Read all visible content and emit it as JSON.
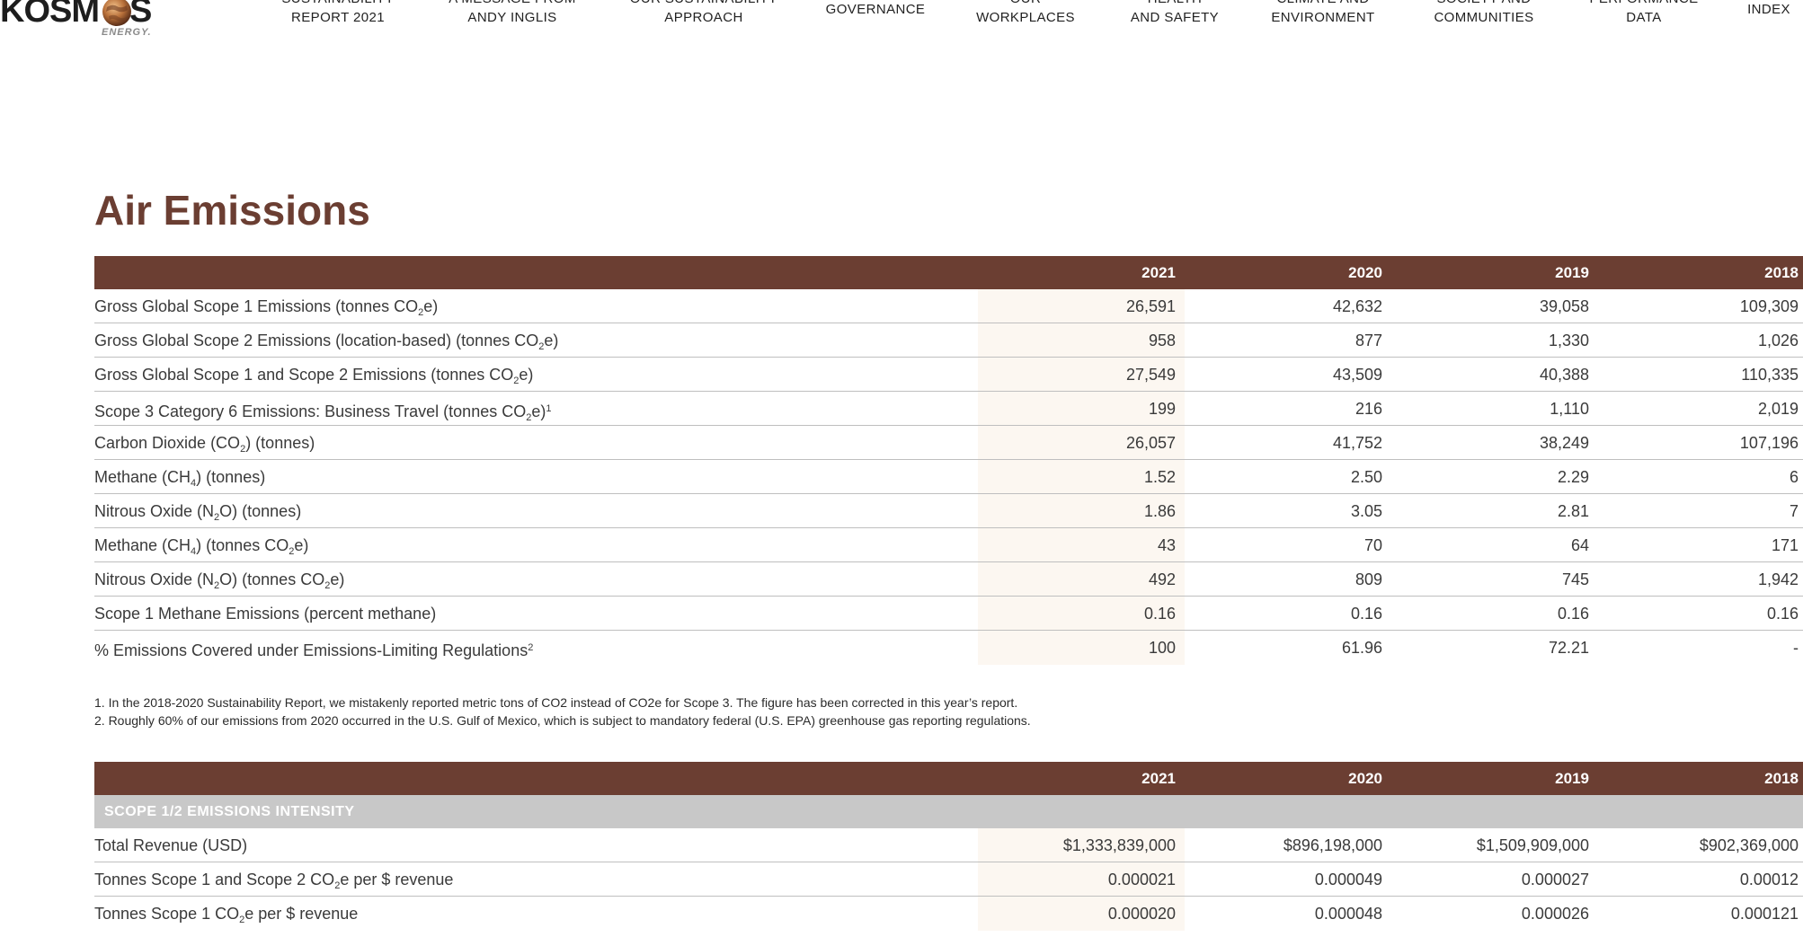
{
  "logo": {
    "text_left": "KOSM",
    "text_right": "S",
    "sub": "ENERGY."
  },
  "nav": [
    {
      "line1": "SUSTAINABILITY",
      "line2": "REPORT 2021"
    },
    {
      "line1": "A MESSAGE FROM",
      "line2": "ANDY INGLIS"
    },
    {
      "line1": "OUR SUSTAINABILITY",
      "line2": "APPROACH"
    },
    {
      "line1": "GOVERNANCE",
      "line2": ""
    },
    {
      "line1": "OUR",
      "line2": "WORKPLACES"
    },
    {
      "line1": "HEALTH",
      "line2": "AND SAFETY"
    },
    {
      "line1": "CLIMATE AND",
      "line2": "ENVIRONMENT"
    },
    {
      "line1": "SOCIETY AND",
      "line2": "COMMUNITIES"
    },
    {
      "line1": "PERFORMANCE",
      "line2": "DATA"
    },
    {
      "line1": "INDEX",
      "line2": ""
    }
  ],
  "page_title": "Air Emissions",
  "colors": {
    "brand_brown": "#6b3e32",
    "highlight_column": "#fcf7f1",
    "section_band": "#c8c8c8"
  },
  "table1": {
    "years": [
      "2021",
      "2020",
      "2019",
      "2018"
    ],
    "rows": [
      {
        "pre": "Gross Global Scope 1 Emissions (tonnes CO",
        "sub": "2",
        "post": "e)",
        "sup": "",
        "values": [
          "26,591",
          "42,632",
          "39,058",
          "109,309"
        ]
      },
      {
        "pre": "Gross Global Scope 2 Emissions (location-based) (tonnes CO",
        "sub": "2",
        "post": "e)",
        "sup": "",
        "values": [
          "958",
          "877",
          "1,330",
          "1,026"
        ]
      },
      {
        "pre": "Gross Global Scope 1 and Scope 2 Emissions (tonnes CO",
        "sub": "2",
        "post": "e)",
        "sup": "",
        "values": [
          "27,549",
          "43,509",
          "40,388",
          "110,335"
        ]
      },
      {
        "pre": "Scope 3 Category 6 Emissions: Business Travel (tonnes CO",
        "sub": "2",
        "post": "e)",
        "sup": "1",
        "values": [
          "199",
          "216",
          "1,110",
          "2,019"
        ]
      },
      {
        "pre": "Carbon Dioxide (CO",
        "sub": "2",
        "post": ") (tonnes)",
        "sup": "",
        "values": [
          "26,057",
          "41,752",
          "38,249",
          "107,196"
        ]
      },
      {
        "pre": "Methane (CH",
        "sub": "4",
        "post": ") (tonnes)",
        "sup": "",
        "values": [
          "1.52",
          "2.50",
          "2.29",
          "6"
        ]
      },
      {
        "pre": "Nitrous Oxide (N",
        "sub": "2",
        "post": "O) (tonnes)",
        "sup": "",
        "values": [
          "1.86",
          "3.05",
          "2.81",
          "7"
        ]
      },
      {
        "pre": "Methane (CH",
        "sub": "4",
        "post": ") (tonnes CO",
        "sub2": "2",
        "post2": "e)",
        "sup": "",
        "values": [
          "43",
          "70",
          "64",
          "171"
        ]
      },
      {
        "pre": "Nitrous Oxide (N",
        "sub": "2",
        "post": "O) (tonnes CO",
        "sub2": "2",
        "post2": "e)",
        "sup": "",
        "values": [
          "492",
          "809",
          "745",
          "1,942"
        ]
      },
      {
        "pre": "Scope 1 Methane Emissions (percent methane)",
        "sub": "",
        "post": "",
        "sup": "",
        "values": [
          "0.16",
          "0.16",
          "0.16",
          "0.16"
        ]
      },
      {
        "pre": "% Emissions Covered under Emissions-Limiting Regulations",
        "sub": "",
        "post": "",
        "sup": "2",
        "values": [
          "100",
          "61.96",
          "72.21",
          "-"
        ]
      }
    ]
  },
  "footnotes": [
    "1.  In the 2018-2020 Sustainability Report, we mistakenly reported metric tons of CO2 instead of CO2e for Scope 3. The figure has been corrected in this year’s report.",
    "2.  Roughly 60% of our emissions from 2020 occurred in the U.S. Gulf of Mexico, which is subject to mandatory federal (U.S. EPA) greenhouse gas reporting regulations."
  ],
  "table2": {
    "years": [
      "2021",
      "2020",
      "2019",
      "2018"
    ],
    "section": "SCOPE 1/2 EMISSIONS INTENSITY",
    "rows": [
      {
        "pre": "Total Revenue (USD)",
        "sub": "",
        "post": "",
        "sup": "",
        "values": [
          "$1,333,839,000",
          "$896,198,000",
          "$1,509,909,000",
          "$902,369,000"
        ]
      },
      {
        "pre": "Tonnes Scope 1 and Scope 2 CO",
        "sub": "2",
        "post": "e per $ revenue",
        "sup": "",
        "values": [
          "0.000021",
          "0.000049",
          "0.000027",
          "0.00012"
        ]
      },
      {
        "pre": "Tonnes Scope 1 CO",
        "sub": "2",
        "post": "e per $ revenue",
        "sup": "",
        "values": [
          "0.000020",
          "0.000048",
          "0.000026",
          "0.000121"
        ]
      }
    ]
  }
}
